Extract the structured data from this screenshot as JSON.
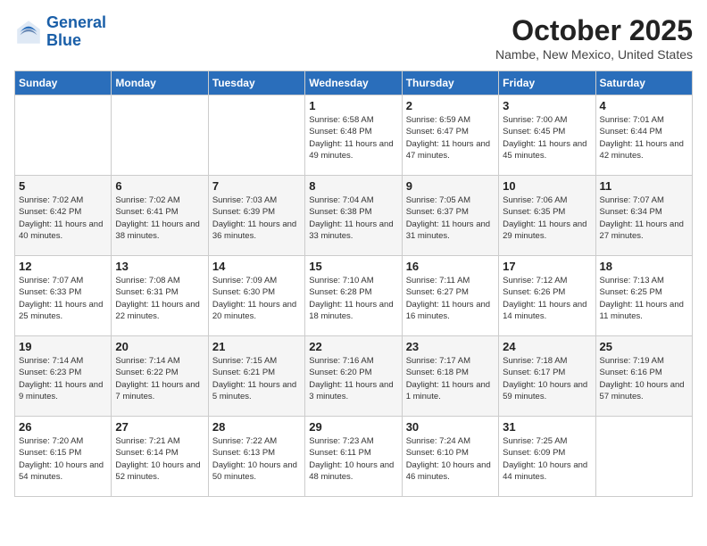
{
  "header": {
    "logo_line1": "General",
    "logo_line2": "Blue",
    "month": "October 2025",
    "location": "Nambe, New Mexico, United States"
  },
  "weekdays": [
    "Sunday",
    "Monday",
    "Tuesday",
    "Wednesday",
    "Thursday",
    "Friday",
    "Saturday"
  ],
  "weeks": [
    [
      {
        "day": "",
        "info": ""
      },
      {
        "day": "",
        "info": ""
      },
      {
        "day": "",
        "info": ""
      },
      {
        "day": "1",
        "info": "Sunrise: 6:58 AM\nSunset: 6:48 PM\nDaylight: 11 hours\nand 49 minutes."
      },
      {
        "day": "2",
        "info": "Sunrise: 6:59 AM\nSunset: 6:47 PM\nDaylight: 11 hours\nand 47 minutes."
      },
      {
        "day": "3",
        "info": "Sunrise: 7:00 AM\nSunset: 6:45 PM\nDaylight: 11 hours\nand 45 minutes."
      },
      {
        "day": "4",
        "info": "Sunrise: 7:01 AM\nSunset: 6:44 PM\nDaylight: 11 hours\nand 42 minutes."
      }
    ],
    [
      {
        "day": "5",
        "info": "Sunrise: 7:02 AM\nSunset: 6:42 PM\nDaylight: 11 hours\nand 40 minutes."
      },
      {
        "day": "6",
        "info": "Sunrise: 7:02 AM\nSunset: 6:41 PM\nDaylight: 11 hours\nand 38 minutes."
      },
      {
        "day": "7",
        "info": "Sunrise: 7:03 AM\nSunset: 6:39 PM\nDaylight: 11 hours\nand 36 minutes."
      },
      {
        "day": "8",
        "info": "Sunrise: 7:04 AM\nSunset: 6:38 PM\nDaylight: 11 hours\nand 33 minutes."
      },
      {
        "day": "9",
        "info": "Sunrise: 7:05 AM\nSunset: 6:37 PM\nDaylight: 11 hours\nand 31 minutes."
      },
      {
        "day": "10",
        "info": "Sunrise: 7:06 AM\nSunset: 6:35 PM\nDaylight: 11 hours\nand 29 minutes."
      },
      {
        "day": "11",
        "info": "Sunrise: 7:07 AM\nSunset: 6:34 PM\nDaylight: 11 hours\nand 27 minutes."
      }
    ],
    [
      {
        "day": "12",
        "info": "Sunrise: 7:07 AM\nSunset: 6:33 PM\nDaylight: 11 hours\nand 25 minutes."
      },
      {
        "day": "13",
        "info": "Sunrise: 7:08 AM\nSunset: 6:31 PM\nDaylight: 11 hours\nand 22 minutes."
      },
      {
        "day": "14",
        "info": "Sunrise: 7:09 AM\nSunset: 6:30 PM\nDaylight: 11 hours\nand 20 minutes."
      },
      {
        "day": "15",
        "info": "Sunrise: 7:10 AM\nSunset: 6:28 PM\nDaylight: 11 hours\nand 18 minutes."
      },
      {
        "day": "16",
        "info": "Sunrise: 7:11 AM\nSunset: 6:27 PM\nDaylight: 11 hours\nand 16 minutes."
      },
      {
        "day": "17",
        "info": "Sunrise: 7:12 AM\nSunset: 6:26 PM\nDaylight: 11 hours\nand 14 minutes."
      },
      {
        "day": "18",
        "info": "Sunrise: 7:13 AM\nSunset: 6:25 PM\nDaylight: 11 hours\nand 11 minutes."
      }
    ],
    [
      {
        "day": "19",
        "info": "Sunrise: 7:14 AM\nSunset: 6:23 PM\nDaylight: 11 hours\nand 9 minutes."
      },
      {
        "day": "20",
        "info": "Sunrise: 7:14 AM\nSunset: 6:22 PM\nDaylight: 11 hours\nand 7 minutes."
      },
      {
        "day": "21",
        "info": "Sunrise: 7:15 AM\nSunset: 6:21 PM\nDaylight: 11 hours\nand 5 minutes."
      },
      {
        "day": "22",
        "info": "Sunrise: 7:16 AM\nSunset: 6:20 PM\nDaylight: 11 hours\nand 3 minutes."
      },
      {
        "day": "23",
        "info": "Sunrise: 7:17 AM\nSunset: 6:18 PM\nDaylight: 11 hours\nand 1 minute."
      },
      {
        "day": "24",
        "info": "Sunrise: 7:18 AM\nSunset: 6:17 PM\nDaylight: 10 hours\nand 59 minutes."
      },
      {
        "day": "25",
        "info": "Sunrise: 7:19 AM\nSunset: 6:16 PM\nDaylight: 10 hours\nand 57 minutes."
      }
    ],
    [
      {
        "day": "26",
        "info": "Sunrise: 7:20 AM\nSunset: 6:15 PM\nDaylight: 10 hours\nand 54 minutes."
      },
      {
        "day": "27",
        "info": "Sunrise: 7:21 AM\nSunset: 6:14 PM\nDaylight: 10 hours\nand 52 minutes."
      },
      {
        "day": "28",
        "info": "Sunrise: 7:22 AM\nSunset: 6:13 PM\nDaylight: 10 hours\nand 50 minutes."
      },
      {
        "day": "29",
        "info": "Sunrise: 7:23 AM\nSunset: 6:11 PM\nDaylight: 10 hours\nand 48 minutes."
      },
      {
        "day": "30",
        "info": "Sunrise: 7:24 AM\nSunset: 6:10 PM\nDaylight: 10 hours\nand 46 minutes."
      },
      {
        "day": "31",
        "info": "Sunrise: 7:25 AM\nSunset: 6:09 PM\nDaylight: 10 hours\nand 44 minutes."
      },
      {
        "day": "",
        "info": ""
      }
    ]
  ]
}
